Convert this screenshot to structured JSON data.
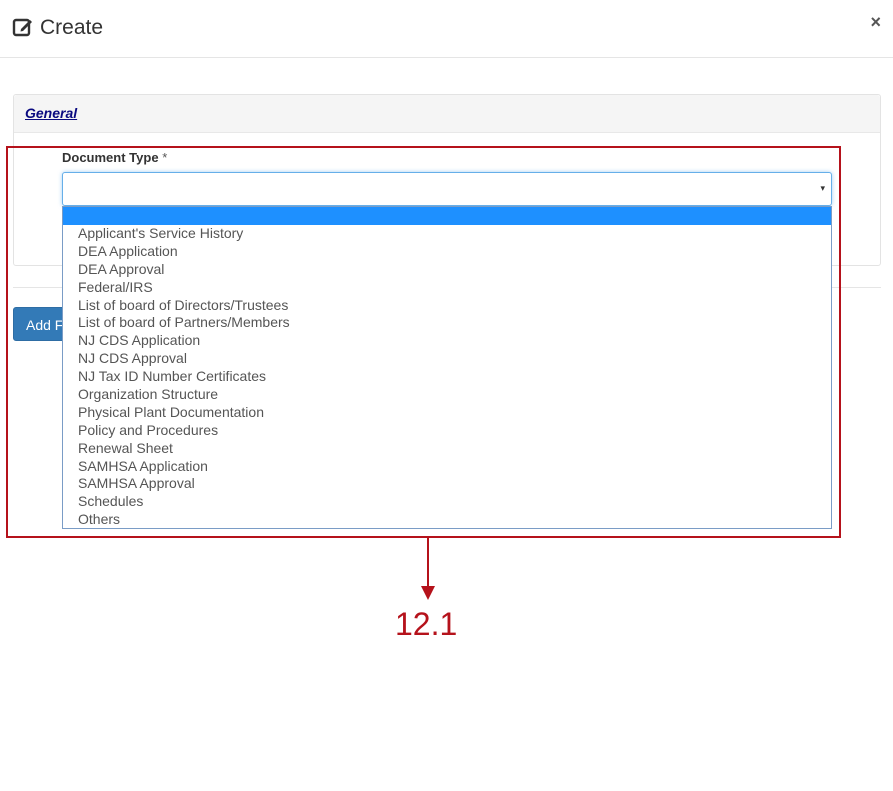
{
  "modal": {
    "title": "Create",
    "close_label": "×",
    "icons": {
      "title": "edit-icon",
      "close": "close-icon"
    }
  },
  "section": {
    "heading": "General"
  },
  "field": {
    "label": "Document Type",
    "required_mark": "*",
    "value": "",
    "caret": "▾"
  },
  "dropdown": {
    "selected_index": 0,
    "options": [
      "",
      "Applicant's Service History",
      "DEA Application",
      "DEA Approval",
      "Federal/IRS",
      "List of board of Directors/Trustees",
      "List of board of Partners/Members",
      "NJ CDS Application",
      "NJ CDS Approval",
      "NJ Tax ID Number Certificates",
      "Organization Structure",
      "Physical Plant Documentation",
      "Policy and Procedures",
      "Renewal Sheet",
      "SAMHSA Application",
      "SAMHSA Approval",
      "Schedules",
      "Others"
    ]
  },
  "add_button": {
    "label": "Add F"
  },
  "annotation": {
    "step": "12.1",
    "color": "#b5121b"
  },
  "colors": {
    "primary_button": "#337ab7",
    "selected_option": "#1e90ff",
    "link": "#0a0a80"
  }
}
